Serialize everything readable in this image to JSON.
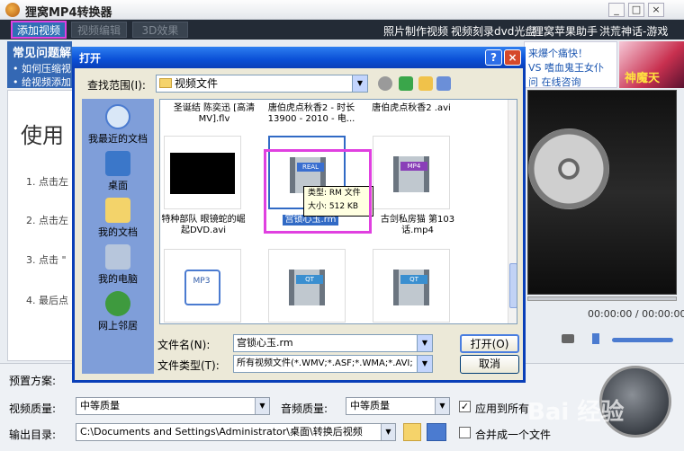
{
  "app": {
    "title": "狸窝MP4转换器",
    "win_min": "_",
    "win_max": "□",
    "win_close": "×"
  },
  "toolbar": {
    "add_video": "添加视频",
    "edit_video": "视频编辑",
    "effect_3d": "3D效果",
    "links": [
      "照片制作视频",
      "视频刻录dvd光盘",
      "狸窝苹果助手",
      "洪荒神话-游戏"
    ]
  },
  "faq": {
    "title": "常见问题解",
    "items": [
      "• 如何压缩视",
      "• 给视频添加"
    ]
  },
  "ad": {
    "line1": "来爆个痛快！",
    "line2": "VS 嗜血鬼王女仆",
    "line3": "问 在线咨询",
    "banner": "神魔天"
  },
  "guide": {
    "title": "使用",
    "steps": [
      "1. 点击左",
      "2. 点击左",
      "3. 点击 \"",
      "4. 最后点"
    ]
  },
  "player": {
    "time": "00:00:00 / 00:00:00"
  },
  "settings": {
    "preset_label": "预置方案:",
    "video_quality_label": "视频质量:",
    "video_quality": "中等质量",
    "audio_quality_label": "音频质量:",
    "audio_quality": "中等质量",
    "apply_all_label": "应用到所有",
    "output_label": "输出目录:",
    "output_path": "C:\\Documents and Settings\\Administrator\\桌面\\转换后视频",
    "merge_label": "合并成一个文件",
    "watermark": "Bai 经验"
  },
  "dialog": {
    "title": "打开",
    "help": "?",
    "close": "×",
    "lookin_label": "查找范围(I):",
    "lookin_value": "视频文件",
    "places": [
      "我最近的文档",
      "桌面",
      "我的文档",
      "我的电脑",
      "网上邻居"
    ],
    "top_names": [
      "圣诞结 陈奕迅 [高清 MV].flv",
      "唐伯虎点秋香2 - 时长 13900 - 2010 - 电...",
      "唐伯虎点秋香2 .avi"
    ],
    "files": [
      {
        "name": "特种部队 眼镜蛇的崛起DVD.avi",
        "badge": ""
      },
      {
        "name": "宫锁心玉.rm",
        "badge": "REAL"
      },
      {
        "name": "古剑私房猫 第103话.mp4",
        "badge": "MP4"
      },
      {
        "name": "",
        "badge": "MP3"
      },
      {
        "name": "",
        "badge": "QT"
      },
      {
        "name": "",
        "badge": "QT"
      }
    ],
    "tooltip_type": "类型: RM 文件",
    "tooltip_size": "大小: 512 KB",
    "filename_label": "文件名(N):",
    "filename_value": "宫锁心玉.rm",
    "filetype_label": "文件类型(T):",
    "filetype_value": "所有视频文件(*.WMV;*.ASF;*.WMA;*.AVI;",
    "open_btn": "打开(O)",
    "cancel_btn": "取消"
  },
  "colors": {
    "accent": "#2f6fb6",
    "dialog_title": "#0a4fd6",
    "highlight": "#e040e0"
  }
}
